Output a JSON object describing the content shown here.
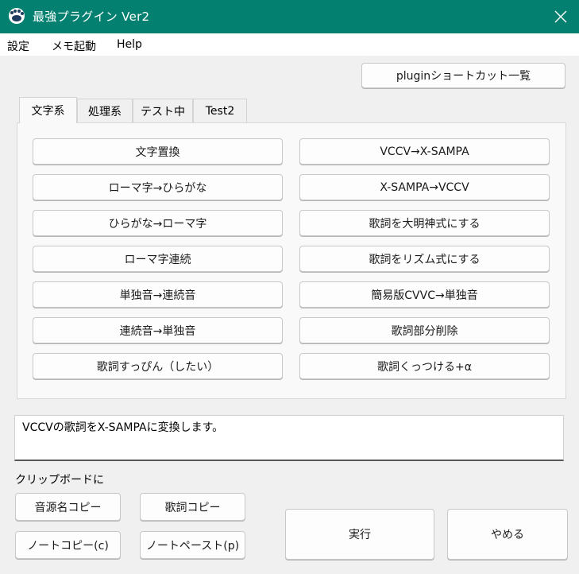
{
  "window": {
    "title": "最強プラグイン Ver2",
    "title_bar_color": "#03806f"
  },
  "menu": {
    "items": [
      "設定",
      "メモ起動",
      "Help"
    ]
  },
  "shortcut_button": "pluginショートカット一覧",
  "tabs": [
    "文字系",
    "処理系",
    "テスト中",
    "Test2"
  ],
  "active_tab": "文字系",
  "left_buttons": [
    "文字置換",
    "ローマ字→ひらがな",
    "ひらがな→ローマ字",
    "ローマ字連続",
    "単独音→連続音",
    "連続音→単独音",
    "歌詞すっぴん（したい）"
  ],
  "right_buttons": [
    "VCCV→X-SAMPA",
    "X-SAMPA→VCCV",
    "歌詞を大明神式にする",
    "歌詞をリズム式にする",
    "簡易版CVVC→単独音",
    "歌詞部分削除",
    "歌詞くっつける+α"
  ],
  "description": "VCCVの歌詞をX-SAMPAに変換します。",
  "clipboard": {
    "label": "クリップボードに",
    "copy_source_name": "音源名コピー",
    "copy_lyrics": "歌詞コピー",
    "copy_notes": "ノートコピー(c)",
    "paste_notes": "ノートペースト(p)"
  },
  "actions": {
    "run": "実行",
    "cancel": "やめる"
  },
  "icons": {
    "app": "paw-icon",
    "close": "close-icon"
  }
}
